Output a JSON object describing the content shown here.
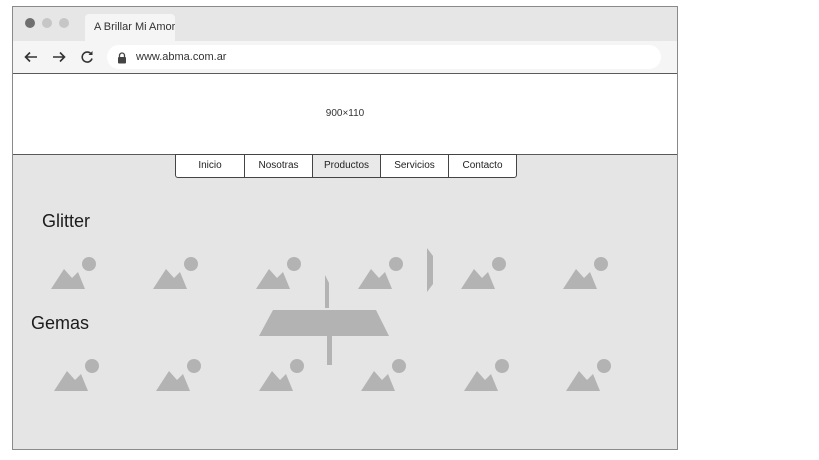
{
  "browser": {
    "tab_title": "A Brillar Mi Amor",
    "url": "www.abma.com.ar"
  },
  "banner": {
    "label": "900×110"
  },
  "menu": {
    "items": [
      {
        "label": "Inicio"
      },
      {
        "label": "Nosotras"
      },
      {
        "label": "Productos",
        "active": true
      },
      {
        "label": "Servicios"
      },
      {
        "label": "Contacto"
      }
    ]
  },
  "sections": [
    {
      "title": "Glitter",
      "image_count": 6
    },
    {
      "title": "Gemas",
      "image_count": 6
    }
  ],
  "colors": {
    "placeholder_gray": "#b3b3b3",
    "page_background": "#e5e5e5"
  }
}
